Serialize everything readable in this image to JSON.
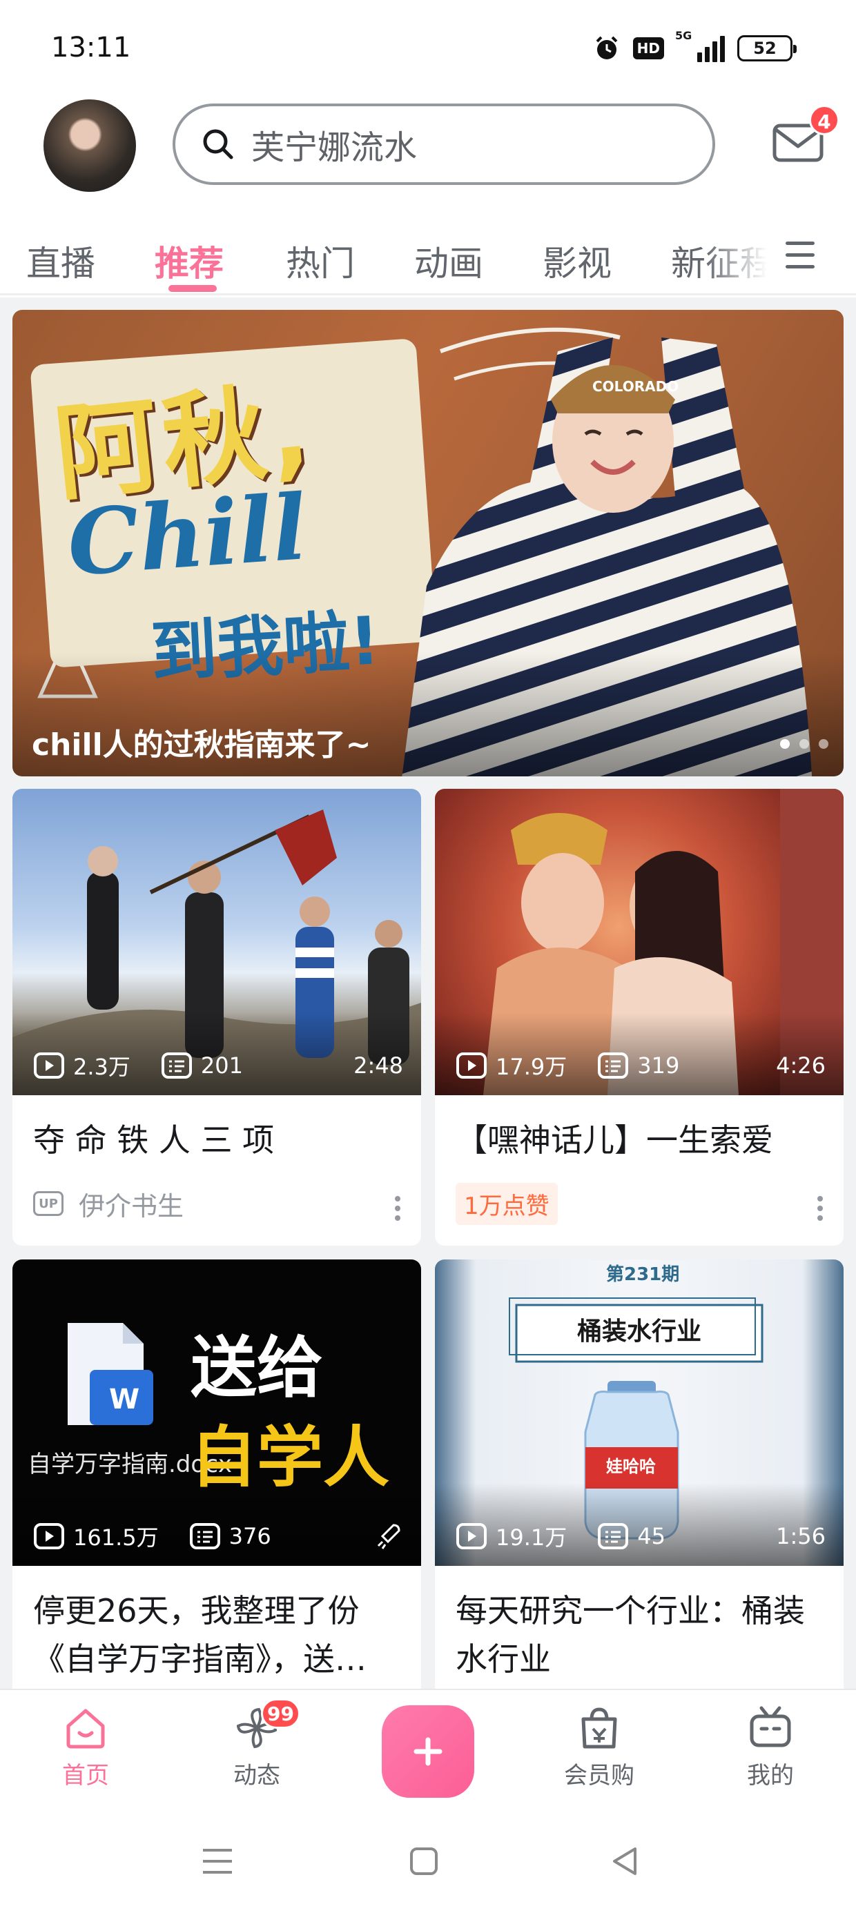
{
  "status_bar": {
    "time": "13:11",
    "network": "5G",
    "hd_label": "HD",
    "battery": "52"
  },
  "header": {
    "search_placeholder": "芙宁娜流水",
    "mail_badge": "4"
  },
  "tabs": {
    "items": [
      {
        "label": "直播",
        "active": false
      },
      {
        "label": "推荐",
        "active": true
      },
      {
        "label": "热门",
        "active": false
      },
      {
        "label": "动画",
        "active": false
      },
      {
        "label": "影视",
        "active": false
      },
      {
        "label": "新征程",
        "active": false
      }
    ]
  },
  "banner": {
    "caption": "chill人的过秋指南来了~",
    "art_line1": "阿秋,",
    "art_line2": "Chill",
    "art_line3": "到我啦!",
    "art_cap": "COLORADO",
    "page_count": 3,
    "current_page": 1
  },
  "videos": [
    {
      "title": "夺 命 铁 人 三 项",
      "plays": "2.3万",
      "danmaku": "201",
      "duration": "2:48",
      "author": "伊介书生",
      "author_tag": "UP"
    },
    {
      "title": "【嘿神话儿】一生索爱",
      "plays": "17.9万",
      "danmaku": "319",
      "duration": "4:26",
      "tag": "1万点赞"
    },
    {
      "title": "停更26天，我整理了份《自学万字指南》，送…",
      "plays": "161.5万",
      "danmaku": "376",
      "thumb_doc_label": "自学万字指南.docx",
      "thumb_word_letter": "W",
      "thumb_text1": "送给",
      "thumb_text2": "自学人"
    },
    {
      "title": "每天研究一个行业：桶装水行业",
      "plays": "19.1万",
      "danmaku": "45",
      "duration": "1:56",
      "thumb_issue": "第231期",
      "thumb_heading": "桶装水行业",
      "thumb_bottle_label": "娃哈哈"
    }
  ],
  "bottom_nav": {
    "items": [
      {
        "label": "首页",
        "icon": "home-icon",
        "active": true
      },
      {
        "label": "动态",
        "icon": "pinwheel-icon",
        "badge": "99"
      },
      {
        "label": "会员购",
        "icon": "shopping-bag-icon"
      },
      {
        "label": "我的",
        "icon": "tv-face-icon"
      }
    ],
    "post_icon": "plus-icon"
  },
  "colors": {
    "accent": "#fb7299",
    "badge": "#ff4d4f",
    "text_secondary": "#9499a0"
  }
}
